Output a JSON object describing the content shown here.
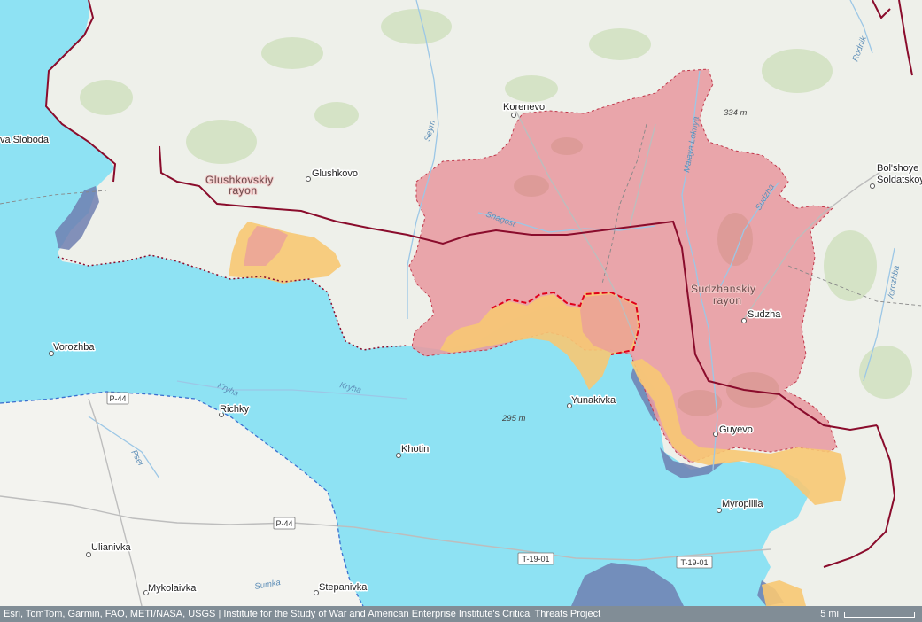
{
  "places": [
    {
      "name": "Korenevo"
    },
    {
      "name": "Glushkovo"
    },
    {
      "name": "Sudzha"
    },
    {
      "name": "Guyevo"
    },
    {
      "name": "Yunakivka"
    },
    {
      "name": "Khotin"
    },
    {
      "name": "Myropillia"
    },
    {
      "name": "Richky"
    },
    {
      "name": "Vorozhba"
    },
    {
      "name": "Ulianivka"
    },
    {
      "name": "Mykolaivka"
    },
    {
      "name": "Stepanivka"
    },
    {
      "name": "va Sloboda"
    },
    {
      "name": "Bol'shoye"
    },
    {
      "name": "Soldatskoy"
    }
  ],
  "regions": {
    "glushkovsky_1": "Glushkovskiy",
    "glushkovsky_2": "rayon",
    "sudzhansky_1": "Sudzhanskiy",
    "sudzhansky_2": "rayon"
  },
  "rivers": {
    "seym": "Seym",
    "snagost": "Snagost",
    "malaya_loknya": "Malaya Loknya",
    "sudzha": "Sudzha",
    "kryha_1": "Kryha",
    "kryha_2": "Kryha",
    "psel": "Psel",
    "sumka": "Sumka",
    "vorozhba": "Vorozhba",
    "rodnik": "Rodnik"
  },
  "elevations": {
    "e1": "334 m",
    "e2": "295 m"
  },
  "roads": {
    "p44_a": "P-44",
    "p44_b": "P-44",
    "t1901_a": "T-19-01",
    "t1901_b": "T-19-01"
  },
  "attribution": "Esri, TomTom, Garmin, FAO, METI/NASA, USGS | Institute for the Study of War and American Enterprise Institute's Critical Threats Project",
  "scale": {
    "label": "5 mi"
  },
  "colors": {
    "ukraine_controlled": "#88e0f3",
    "russian_advance_red": "#e89aa0",
    "contested_yellow": "#f7c873",
    "dark_blue": "#6f7fb0",
    "land": "#eef0ea",
    "border": "#8a0c2c"
  }
}
